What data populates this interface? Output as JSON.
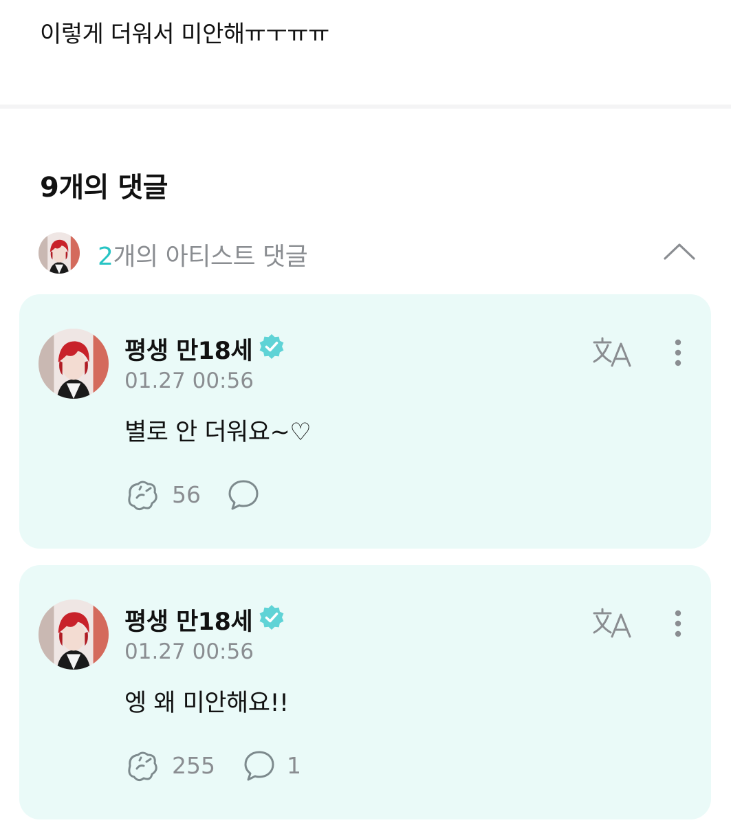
{
  "post": {
    "text": "이렇게 더워서 미안해ㅠㅜㅠㅠ"
  },
  "comments": {
    "count_label": "9개의 댓글"
  },
  "artist_comments": {
    "count": "2",
    "label": "개의 아티스트 댓글",
    "collapse_icon": "chevron-up-icon"
  },
  "cards": [
    {
      "name": "평생 만18세",
      "time": "01.27 00:56",
      "text": "별로 안 더워요~♡",
      "cheers": "56",
      "replies": ""
    },
    {
      "name": "평생 만18세",
      "time": "01.27 00:56",
      "text": "엥 왜 미안해요!!",
      "cheers": "255",
      "replies": "1"
    }
  ],
  "colors": {
    "accent": "#27c4c4",
    "card_background": "#eafaf8",
    "muted_text": "#8a8d91",
    "verified_badge": "#5fd3d6",
    "icon_stroke": "#7d8a8d"
  },
  "icons": {
    "verified": "verified-badge-icon",
    "translate": "translate-icon",
    "more": "more-vertical-icon",
    "cheer": "cheer-icon",
    "reply": "comment-bubble-icon"
  }
}
